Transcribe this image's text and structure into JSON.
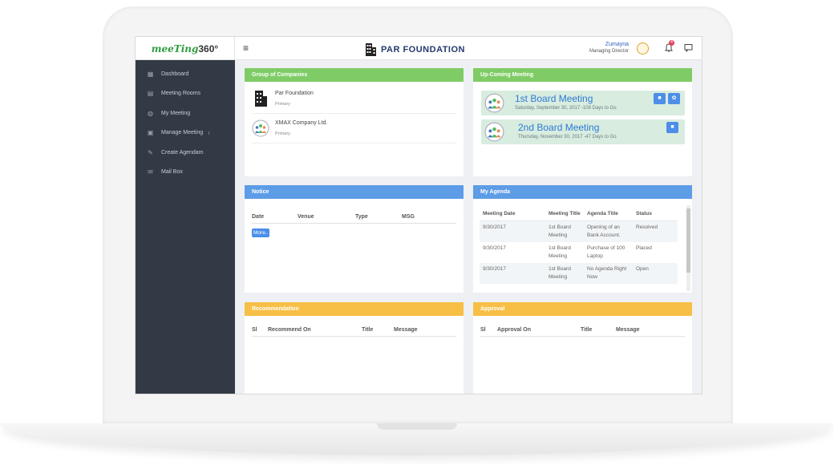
{
  "header": {
    "logo_main": "meeTing",
    "logo_num": "360°",
    "menu_glyph": "≡",
    "org_name": "PAR FOUNDATION",
    "user_name": "Zumayna",
    "user_role": "Managing Director",
    "notification_count": "4"
  },
  "sidebar": {
    "items": [
      {
        "label": "Dashboard",
        "icon": "dashboard-icon"
      },
      {
        "label": "Meeting Rooms",
        "icon": "meeting-rooms-icon"
      },
      {
        "label": "My Meeting",
        "icon": "globe-icon"
      },
      {
        "label": "Manage Meeting",
        "icon": "manage-icon",
        "chevron": "›"
      },
      {
        "label": "Create Agendam",
        "icon": "pencil-icon"
      },
      {
        "label": "Mail Box",
        "icon": "mailbox-icon"
      }
    ]
  },
  "groups": {
    "title": "Group of Companies",
    "companies": [
      {
        "name": "Par Foundation",
        "tag": "Primary",
        "icon": "building-icon"
      },
      {
        "name": "XMAX Company Ltd.",
        "tag": "Primary",
        "icon": "group-icon"
      }
    ]
  },
  "upcoming": {
    "title": "Up-Coming Meeting",
    "meetings": [
      {
        "title": "1st Board Meeting",
        "date": "Saturday, September 30, 2017 -108 Days to Go"
      },
      {
        "title": "2nd Board Meeting",
        "date": "Thursday, November 30, 2017 -47 Days to Go"
      }
    ]
  },
  "notice": {
    "title": "Notice",
    "columns": [
      "Date",
      "Venue",
      "Type",
      "MSG"
    ],
    "more_label": "More.."
  },
  "agenda": {
    "title": "My Agenda",
    "columns": [
      "Meeting Date",
      "Meeting Title",
      "Agenda Title",
      "Status"
    ],
    "rows": [
      [
        "9/30/2017",
        "1st Board Meeting",
        "Opening of an Bank Account.",
        "Resolved"
      ],
      [
        "9/30/2017",
        "1st Board Meeting",
        "Purchase of 100 Laptop",
        "Placed"
      ],
      [
        "9/30/2017",
        "1st Board Meeting",
        "No Agenda Right Now",
        "Open"
      ]
    ]
  },
  "recommendation": {
    "title": "Recommendation",
    "columns": [
      "Sl",
      "Recommend On",
      "Title",
      "Message"
    ]
  },
  "approval": {
    "title": "Approval",
    "columns": [
      "Sl",
      "Approval On",
      "Title",
      "Message"
    ]
  },
  "colors": {
    "sidebar": "#323a45",
    "green": "#7fcc66",
    "blue": "#5d9ce6",
    "orange": "#f7bf45",
    "link": "#2c7ad6"
  }
}
